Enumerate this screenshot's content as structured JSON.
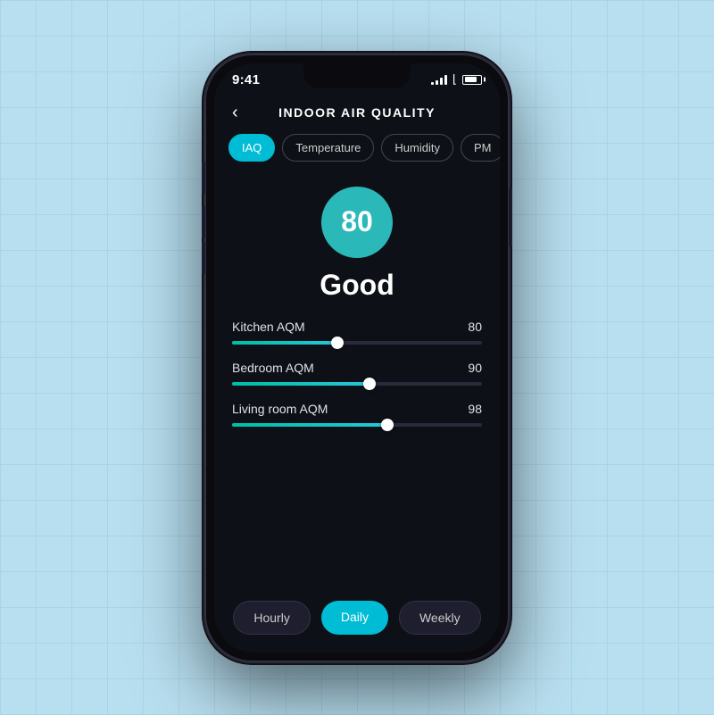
{
  "status_bar": {
    "time": "9:41",
    "signal_bars": [
      3,
      6,
      9,
      12
    ],
    "battery_percent": 80
  },
  "header": {
    "back_label": "‹",
    "title": "INDOOR AIR QUALITY"
  },
  "tabs": [
    {
      "id": "iaq",
      "label": "IAQ",
      "active": true
    },
    {
      "id": "temperature",
      "label": "Temperature",
      "active": false
    },
    {
      "id": "humidity",
      "label": "Humidity",
      "active": false
    },
    {
      "id": "pm",
      "label": "PM",
      "active": false
    }
  ],
  "score": {
    "value": "80",
    "label": "Good"
  },
  "sensors": [
    {
      "name": "Kitchen AQM",
      "value": "80",
      "fill_percent": 42
    },
    {
      "name": "Bedroom AQM",
      "value": "90",
      "fill_percent": 55
    },
    {
      "name": "Living room AQM",
      "value": "98",
      "fill_percent": 62
    }
  ],
  "bottom_tabs": [
    {
      "id": "hourly",
      "label": "Hourly",
      "active": false
    },
    {
      "id": "daily",
      "label": "Daily",
      "active": true
    },
    {
      "id": "weekly",
      "label": "Weekly",
      "active": false
    }
  ]
}
